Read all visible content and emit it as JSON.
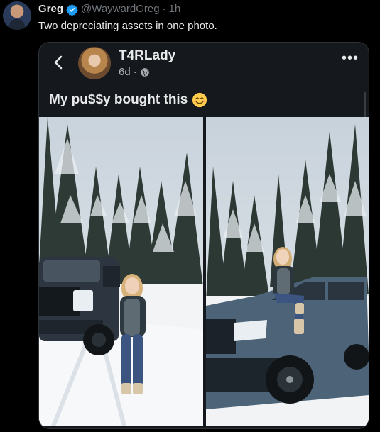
{
  "tweet": {
    "author_name": "Greg",
    "handle": "@WaywardGreg",
    "separator": "·",
    "time": "1h",
    "text": "Two depreciating assets in one photo.",
    "verified": true
  },
  "embed": {
    "author_name": "T4RLady",
    "time": "6d",
    "separator": "·",
    "caption": "My pu$$y bought this",
    "more_label": "•••",
    "icons": [
      "back-chevron-icon",
      "globe-icon",
      "smiling-face-emoji"
    ]
  },
  "colors": {
    "background": "#000000",
    "card": "#15181c",
    "text": "#e7e9ea",
    "muted": "#71767b",
    "verified": "#1d9bf0"
  }
}
